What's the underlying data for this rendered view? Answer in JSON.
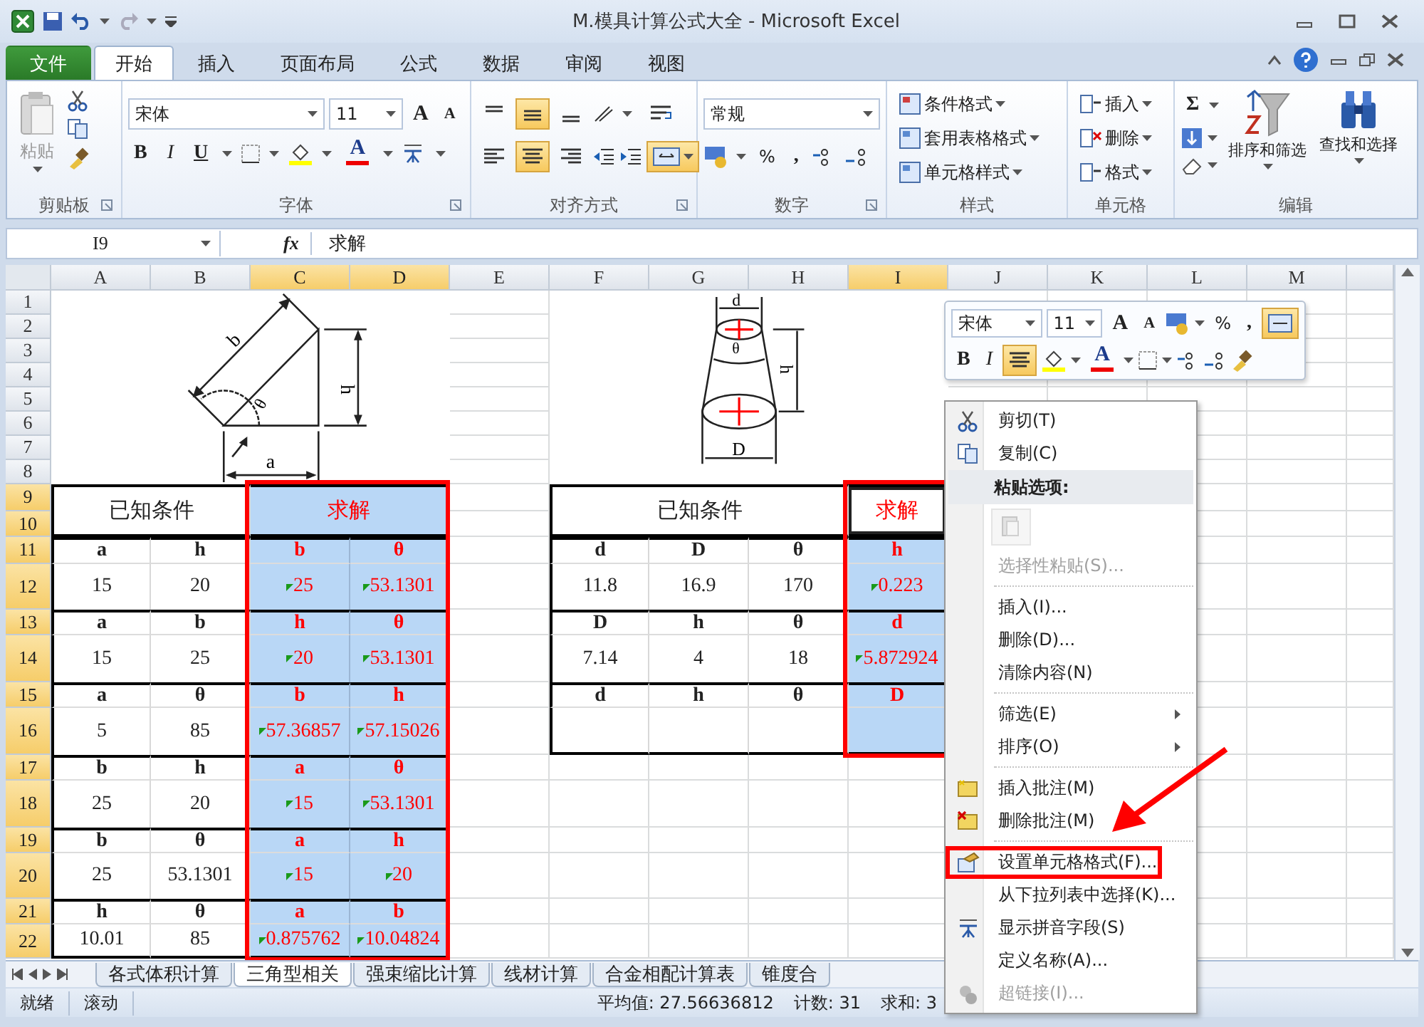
{
  "window": {
    "title": "M.模具计算公式大全 - Microsoft Excel"
  },
  "ribbon_tabs": [
    {
      "label": "文件",
      "kind": "file",
      "selected": false
    },
    {
      "label": "开始",
      "kind": "tab",
      "selected": true
    },
    {
      "label": "插入",
      "kind": "tab",
      "selected": false
    },
    {
      "label": "页面布局",
      "kind": "tab",
      "selected": false
    },
    {
      "label": "公式",
      "kind": "tab",
      "selected": false
    },
    {
      "label": "数据",
      "kind": "tab",
      "selected": false
    },
    {
      "label": "审阅",
      "kind": "tab",
      "selected": false
    },
    {
      "label": "视图",
      "kind": "tab",
      "selected": false
    }
  ],
  "ribbon": {
    "clipboard": {
      "label": "剪贴板",
      "paste": "粘贴"
    },
    "font": {
      "label": "字体",
      "name": "宋体",
      "size": "11",
      "grow": "A",
      "shrink": "A",
      "bold": "B",
      "italic": "I",
      "underline": "U",
      "font_color_letter": "A"
    },
    "alignment": {
      "label": "对齐方式",
      "vertical": [
        {
          "selected": false
        },
        {
          "selected": true
        },
        {
          "selected": false
        }
      ],
      "horizontal": [
        {
          "selected": false
        },
        {
          "selected": true
        },
        {
          "selected": false
        }
      ],
      "merge_selected": true
    },
    "number": {
      "label": "数字",
      "format": "常规",
      "percent": "%",
      "comma": ","
    },
    "styles": {
      "label": "样式",
      "items": [
        "条件格式",
        "套用表格格式",
        "单元格样式"
      ]
    },
    "cells": {
      "label": "单元格",
      "items": [
        "插入",
        "删除",
        "格式"
      ]
    },
    "editing": {
      "label": "编辑",
      "sum": "Σ",
      "sort": "排序和筛选",
      "find": "查找和选择"
    }
  },
  "formula_bar": {
    "name_box": "I9",
    "fx": "fx",
    "formula": "求解"
  },
  "sheet": {
    "columns": [
      {
        "label": "A",
        "selected": false
      },
      {
        "label": "B",
        "selected": false
      },
      {
        "label": "C",
        "selected": true
      },
      {
        "label": "D",
        "selected": true
      },
      {
        "label": "E",
        "selected": false
      },
      {
        "label": "F",
        "selected": false
      },
      {
        "label": "G",
        "selected": false
      },
      {
        "label": "H",
        "selected": false
      },
      {
        "label": "I",
        "selected": true
      },
      {
        "label": "J",
        "selected": false
      },
      {
        "label": "K",
        "selected": false
      },
      {
        "label": "L",
        "selected": false
      },
      {
        "label": "M",
        "selected": false
      }
    ],
    "rows": [
      {
        "label": "1",
        "selected": false
      },
      {
        "label": "2",
        "selected": false
      },
      {
        "label": "3",
        "selected": false
      },
      {
        "label": "4",
        "selected": false
      },
      {
        "label": "5",
        "selected": false
      },
      {
        "label": "6",
        "selected": false
      },
      {
        "label": "7",
        "selected": false
      },
      {
        "label": "8",
        "selected": false
      },
      {
        "label": "9",
        "selected": true
      },
      {
        "label": "10",
        "selected": true
      },
      {
        "label": "11",
        "selected": true
      },
      {
        "label": "12",
        "selected": true
      },
      {
        "label": "13",
        "selected": true
      },
      {
        "label": "14",
        "selected": true
      },
      {
        "label": "15",
        "selected": true
      },
      {
        "label": "16",
        "selected": true
      },
      {
        "label": "17",
        "selected": true
      },
      {
        "label": "18",
        "selected": true
      },
      {
        "label": "19",
        "selected": true
      },
      {
        "label": "20",
        "selected": true
      },
      {
        "label": "21",
        "selected": true
      },
      {
        "label": "22",
        "selected": true
      }
    ],
    "triangle_diagram": {
      "labels": [
        "b",
        "h",
        "θ",
        "a"
      ]
    },
    "cone_diagram": {
      "labels": [
        "d",
        "θ",
        "h",
        "D"
      ]
    },
    "tables": [
      {
        "known_title": "已知条件",
        "solve_title": "求解",
        "solve_selected": true,
        "solve_title_active": false,
        "annotated": true,
        "sections": [
          {
            "known": [
              {
                "name": "a",
                "value": "15"
              },
              {
                "name": "h",
                "value": "20"
              }
            ],
            "solved": [
              {
                "name": "b",
                "value": "25"
              },
              {
                "name": "θ",
                "value": "53.1301"
              }
            ]
          },
          {
            "known": [
              {
                "name": "a",
                "value": "15"
              },
              {
                "name": "b",
                "value": "25"
              }
            ],
            "solved": [
              {
                "name": "h",
                "value": "20"
              },
              {
                "name": "θ",
                "value": "53.1301"
              }
            ]
          },
          {
            "known": [
              {
                "name": "a",
                "value": "5"
              },
              {
                "name": "θ",
                "value": "85"
              }
            ],
            "solved": [
              {
                "name": "b",
                "value": "57.36857"
              },
              {
                "name": "h",
                "value": "57.15026"
              }
            ]
          },
          {
            "known": [
              {
                "name": "b",
                "value": "25"
              },
              {
                "name": "h",
                "value": "20"
              }
            ],
            "solved": [
              {
                "name": "a",
                "value": "15"
              },
              {
                "name": "θ",
                "value": "53.1301"
              }
            ]
          },
          {
            "known": [
              {
                "name": "b",
                "value": "25"
              },
              {
                "name": "θ",
                "value": "53.1301"
              }
            ],
            "solved": [
              {
                "name": "a",
                "value": "15"
              },
              {
                "name": "h",
                "value": "20"
              }
            ]
          },
          {
            "known": [
              {
                "name": "h",
                "value": "10.01"
              },
              {
                "name": "θ",
                "value": "85"
              }
            ],
            "solved": [
              {
                "name": "a",
                "value": "0.875762"
              },
              {
                "name": "b",
                "value": "10.04824"
              }
            ]
          }
        ]
      },
      {
        "known_title": "已知条件",
        "solve_title": "求解",
        "solve_selected": true,
        "solve_title_active": true,
        "annotated": true,
        "sections": [
          {
            "known": [
              {
                "name": "d",
                "value": "11.8"
              },
              {
                "name": "D",
                "value": "16.9"
              },
              {
                "name": "θ",
                "value": "170"
              }
            ],
            "solved": [
              {
                "name": "h",
                "value": "0.223"
              }
            ]
          },
          {
            "known": [
              {
                "name": "D",
                "value": "7.14"
              },
              {
                "name": "h",
                "value": "4"
              },
              {
                "name": "θ",
                "value": "18"
              }
            ],
            "solved": [
              {
                "name": "d",
                "value": "5.872924"
              }
            ]
          },
          {
            "known": [
              {
                "name": "d"
              },
              {
                "name": "h"
              },
              {
                "name": "θ"
              }
            ],
            "solved": [
              {
                "name": "D"
              }
            ]
          }
        ]
      }
    ]
  },
  "sheet_tabs": [
    {
      "label": "各式体积计算",
      "selected": false
    },
    {
      "label": "三角型相关",
      "selected": true
    },
    {
      "label": "强束缩比计算",
      "selected": false
    },
    {
      "label": "线材计算",
      "selected": false
    },
    {
      "label": "合金相配计算表",
      "selected": false
    },
    {
      "label": "锥度合",
      "selected": false
    }
  ],
  "status_bar": {
    "mode": "就绪",
    "scroll": "滚动",
    "average": "平均值: 27.56636812",
    "count": "计数: 31",
    "sum": "求和: 3"
  },
  "mini_toolbar": {
    "font": "宋体",
    "size": "11",
    "grow": "A",
    "shrink": "A",
    "percent": "%",
    "comma": ",",
    "merge_selected": true,
    "bold": "B",
    "italic": "I",
    "center_selected": true,
    "font_color_letter": "A"
  },
  "context_menu": [
    [
      {
        "kind": "item",
        "label": "剪切(T)",
        "disabled": false,
        "submenu": false,
        "annotated": false
      },
      {
        "kind": "item",
        "label": "复制(C)",
        "disabled": false,
        "submenu": false,
        "annotated": false
      },
      {
        "kind": "header",
        "label": "粘贴选项:"
      },
      {
        "kind": "paste_button",
        "disabled": true
      },
      {
        "kind": "item",
        "label": "选择性粘贴(S)...",
        "disabled": true,
        "submenu": false,
        "annotated": false
      }
    ],
    [
      {
        "kind": "item",
        "label": "插入(I)...",
        "disabled": false,
        "submenu": false,
        "annotated": false
      },
      {
        "kind": "item",
        "label": "删除(D)...",
        "disabled": false,
        "submenu": false,
        "annotated": false
      },
      {
        "kind": "item",
        "label": "清除内容(N)",
        "disabled": false,
        "submenu": false,
        "annotated": false
      }
    ],
    [
      {
        "kind": "item",
        "label": "筛选(E)",
        "disabled": false,
        "submenu": true,
        "annotated": false
      },
      {
        "kind": "item",
        "label": "排序(O)",
        "disabled": false,
        "submenu": true,
        "annotated": false
      }
    ],
    [
      {
        "kind": "item",
        "label": "插入批注(M)",
        "disabled": false,
        "submenu": false,
        "annotated": false
      },
      {
        "kind": "item",
        "label": "删除批注(M)",
        "disabled": false,
        "submenu": false,
        "annotated": false
      }
    ],
    [
      {
        "kind": "item",
        "label": "设置单元格格式(F)...",
        "disabled": false,
        "submenu": false,
        "annotated": true
      },
      {
        "kind": "item",
        "label": "从下拉列表中选择(K)...",
        "disabled": false,
        "submenu": false,
        "annotated": false
      },
      {
        "kind": "item",
        "label": "显示拼音字段(S)",
        "disabled": false,
        "submenu": false,
        "annotated": false
      },
      {
        "kind": "item",
        "label": "定义名称(A)...",
        "disabled": false,
        "submenu": false,
        "annotated": false
      },
      {
        "kind": "item",
        "label": "超链接(I)...",
        "disabled": true,
        "submenu": false,
        "annotated": false
      }
    ]
  ]
}
